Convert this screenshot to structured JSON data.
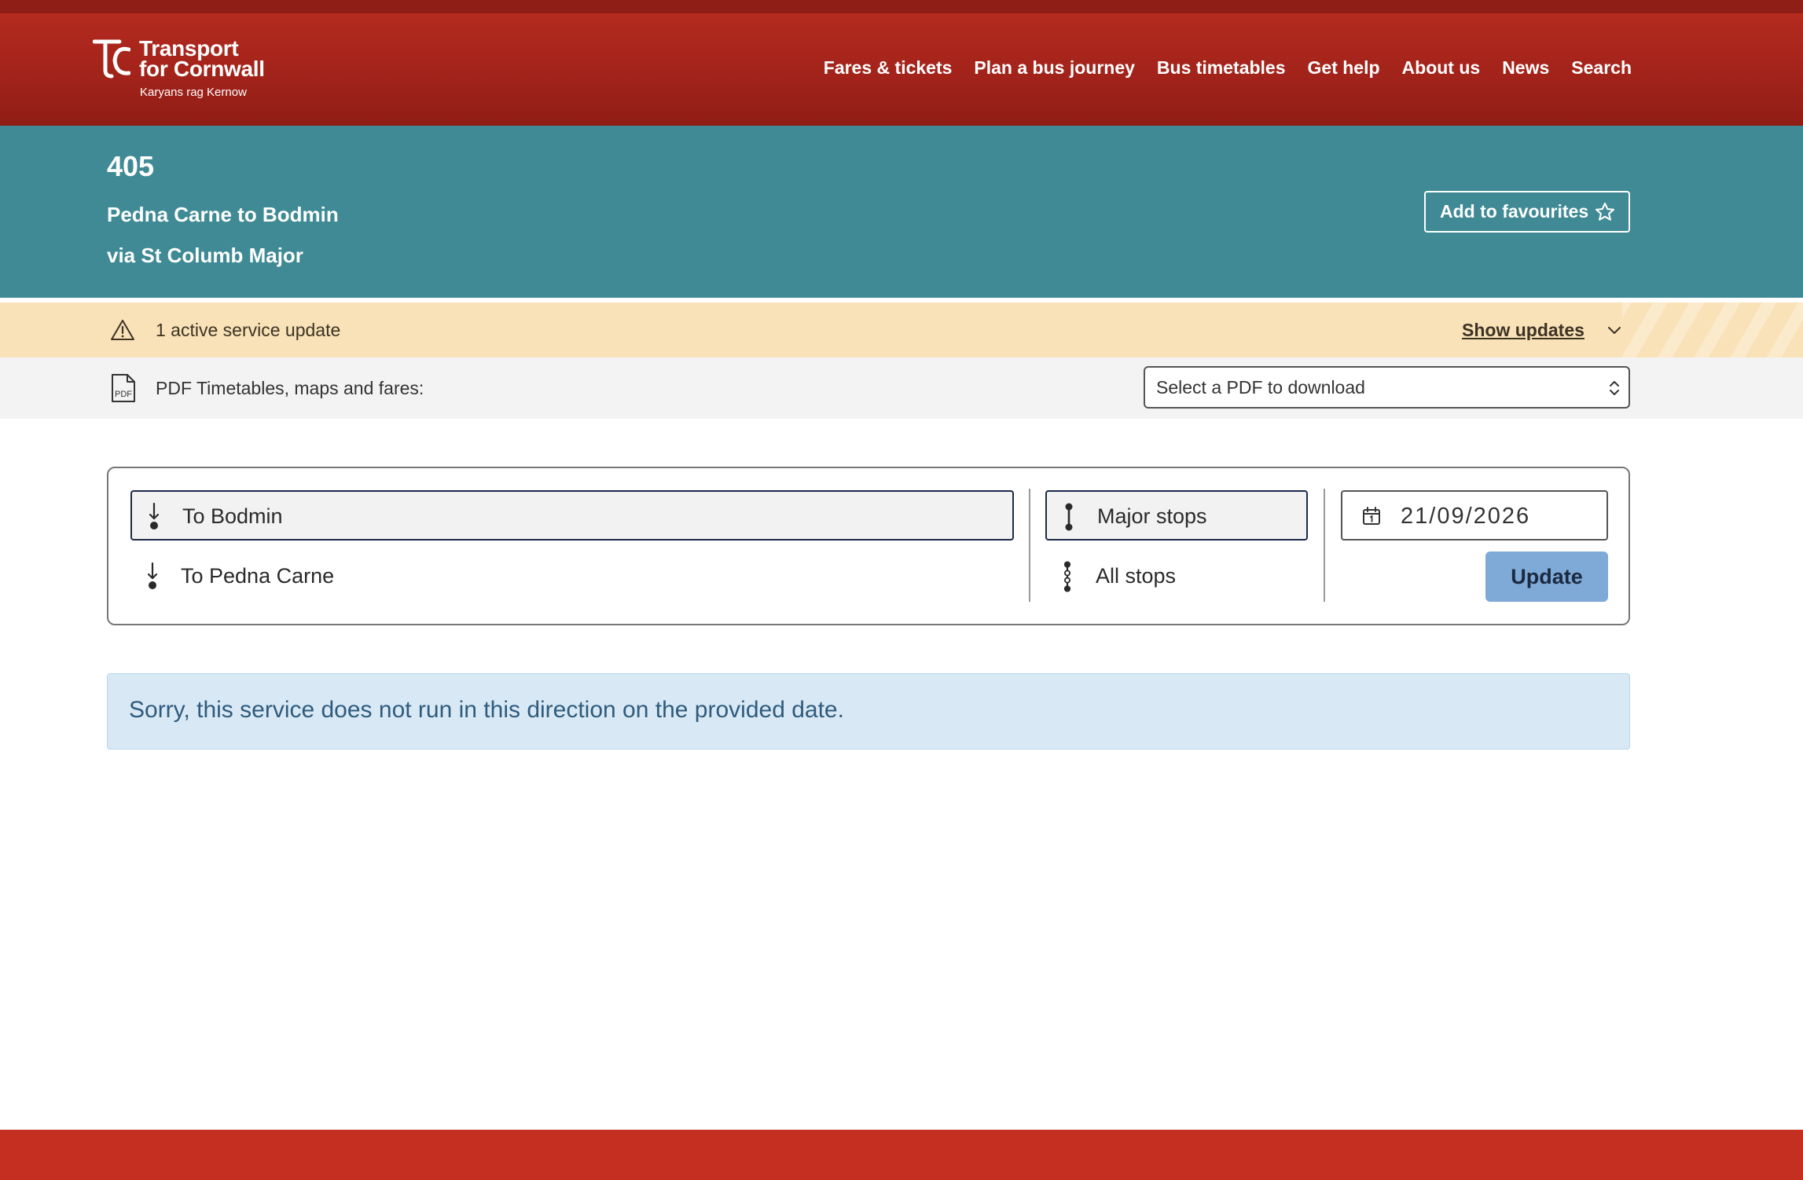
{
  "brand": {
    "name_line1": "Transport",
    "name_line2": "for Cornwall",
    "tagline": "Karyans rag Kernow",
    "primary_color": "#a2231a",
    "accent_color": "#3f8a94"
  },
  "nav": {
    "items": [
      {
        "label": "Fares & tickets"
      },
      {
        "label": "Plan a bus journey"
      },
      {
        "label": "Bus timetables"
      },
      {
        "label": "Get help"
      },
      {
        "label": "About us"
      },
      {
        "label": "News"
      },
      {
        "label": "Search"
      }
    ]
  },
  "route": {
    "number": "405",
    "name": "Pedna Carne to Bodmin",
    "via": "via St Columb Major",
    "favourite_label": "Add to favourites"
  },
  "service_update": {
    "text": "1 active service update",
    "toggle_label": "Show updates"
  },
  "pdf": {
    "label": "PDF Timetables, maps and fares:",
    "select_placeholder": "Select a PDF to download",
    "icon_text": "PDF"
  },
  "filters": {
    "directions": [
      {
        "label": "To Bodmin",
        "selected": true
      },
      {
        "label": "To Pedna Carne",
        "selected": false
      }
    ],
    "stops": [
      {
        "label": "Major stops",
        "selected": true
      },
      {
        "label": "All stops",
        "selected": false
      }
    ],
    "date": "21/09/2026",
    "update_label": "Update"
  },
  "message": {
    "text": "Sorry, this service does not run in this direction on the provided date."
  }
}
